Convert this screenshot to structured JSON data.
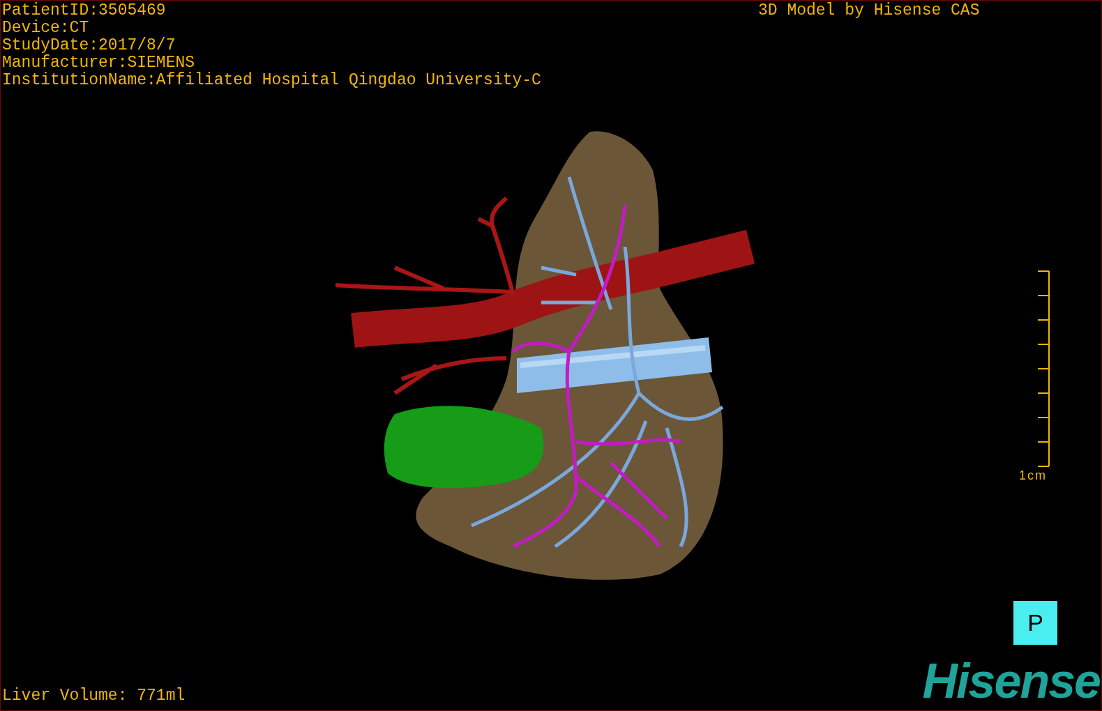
{
  "patient_info": [
    "PatientID:3505469",
    "Device:CT",
    "StudyDate:2017/8/7",
    "Manufacturer:SIEMENS",
    "InstitutionName:Affiliated Hospital Qingdao University-C"
  ],
  "model_credit": "3D Model by Hisense CAS",
  "scale_bar": {
    "label": "1cm"
  },
  "orientation_marker": {
    "label": "P"
  },
  "logo": "Hisense",
  "liver_volume": "Liver Volume: 771ml"
}
